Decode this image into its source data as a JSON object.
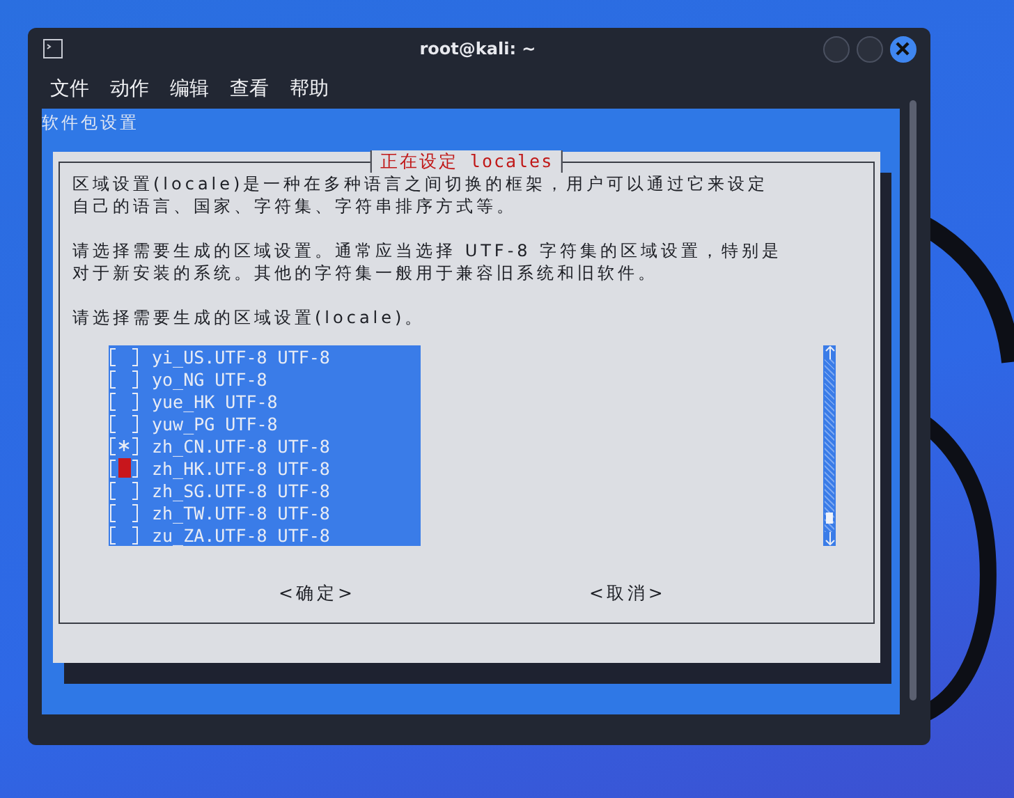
{
  "window": {
    "title": "root@kali: ~"
  },
  "menu": [
    "文件",
    "动作",
    "编辑",
    "查看",
    "帮助"
  ],
  "terminal": {
    "header": "软件包设置",
    "dialog": {
      "title": "正在设定 locales",
      "paragraphs": [
        [
          "区域设置(locale)是一种在多种语言之间切换的框架，用户可以通过它来设定",
          "自己的语言、国家、字符集、字符串排序方式等。"
        ],
        [
          "请选择需要生成的区域设置。通常应当选择 UTF-8 字符集的区域设置，特别是",
          "对于新安装的系统。其他的字符集一般用于兼容旧系统和旧软件。"
        ],
        [
          "请选择需要生成的区域设置(locale)。"
        ]
      ],
      "items": [
        {
          "label": "yi_US.UTF-8 UTF-8",
          "checked": false,
          "selected": false
        },
        {
          "label": "yo_NG UTF-8",
          "checked": false,
          "selected": false
        },
        {
          "label": "yue_HK UTF-8",
          "checked": false,
          "selected": false
        },
        {
          "label": "yuw_PG UTF-8",
          "checked": false,
          "selected": false
        },
        {
          "label": "zh_CN.UTF-8 UTF-8",
          "checked": true,
          "selected": false
        },
        {
          "label": "zh_HK.UTF-8 UTF-8",
          "checked": false,
          "selected": true
        },
        {
          "label": "zh_SG.UTF-8 UTF-8",
          "checked": false,
          "selected": false
        },
        {
          "label": "zh_TW.UTF-8 UTF-8",
          "checked": false,
          "selected": false
        },
        {
          "label": "zu_ZA.UTF-8 UTF-8",
          "checked": false,
          "selected": false
        }
      ],
      "buttons": [
        "<确定>",
        "<取消>"
      ]
    }
  }
}
